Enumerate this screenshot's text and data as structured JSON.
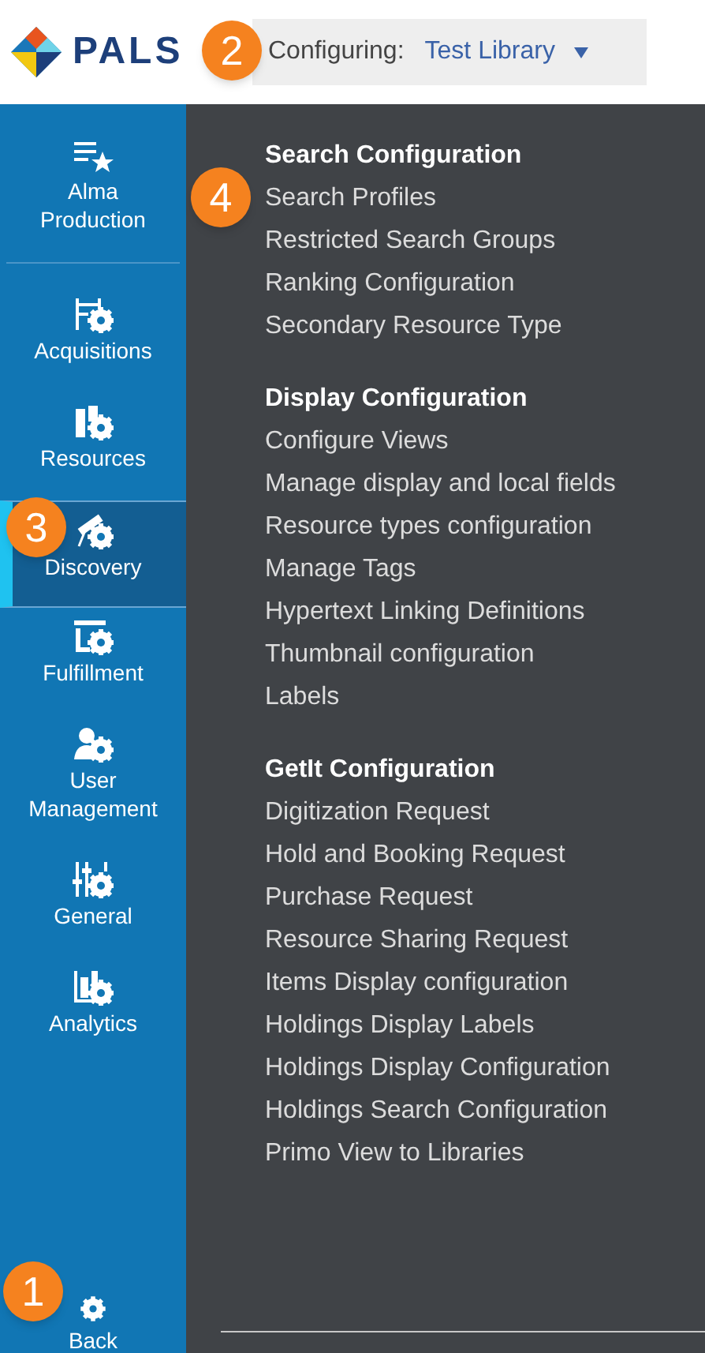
{
  "header": {
    "logo_text": "PALS",
    "configuring_label": "Configuring:",
    "library": "Test Library",
    "callout": "2"
  },
  "nav": [
    {
      "label": "Alma Production",
      "selected": false
    },
    {
      "label": "Acquisitions",
      "selected": false
    },
    {
      "label": "Resources",
      "selected": false
    },
    {
      "label": "Discovery",
      "selected": true,
      "callout": "3"
    },
    {
      "label": "Fulfillment",
      "selected": false
    },
    {
      "label": "User Management",
      "selected": false
    },
    {
      "label": "General",
      "selected": false
    },
    {
      "label": "Analytics",
      "selected": false
    }
  ],
  "back": {
    "label": "Back",
    "callout": "1"
  },
  "menu": [
    {
      "heading": "Search Configuration",
      "items": [
        {
          "label": "Search Profiles",
          "callout": "4"
        },
        {
          "label": "Restricted Search Groups"
        },
        {
          "label": "Ranking Configuration"
        },
        {
          "label": "Secondary Resource Type"
        }
      ]
    },
    {
      "heading": "Display Configuration",
      "items": [
        {
          "label": "Configure Views"
        },
        {
          "label": "Manage display and local fields"
        },
        {
          "label": "Resource types configuration"
        },
        {
          "label": "Manage Tags"
        },
        {
          "label": "Hypertext Linking Definitions"
        },
        {
          "label": "Thumbnail configuration"
        },
        {
          "label": "Labels"
        }
      ]
    },
    {
      "heading": "GetIt Configuration",
      "items": [
        {
          "label": "Digitization Request"
        },
        {
          "label": "Hold and Booking Request"
        },
        {
          "label": "Purchase Request"
        },
        {
          "label": "Resource Sharing Request"
        },
        {
          "label": "Items Display configuration"
        },
        {
          "label": "Holdings Display Labels"
        },
        {
          "label": "Holdings Display Configuration"
        },
        {
          "label": "Holdings Search Configuration"
        },
        {
          "label": "Primo View to Libraries"
        }
      ]
    }
  ]
}
